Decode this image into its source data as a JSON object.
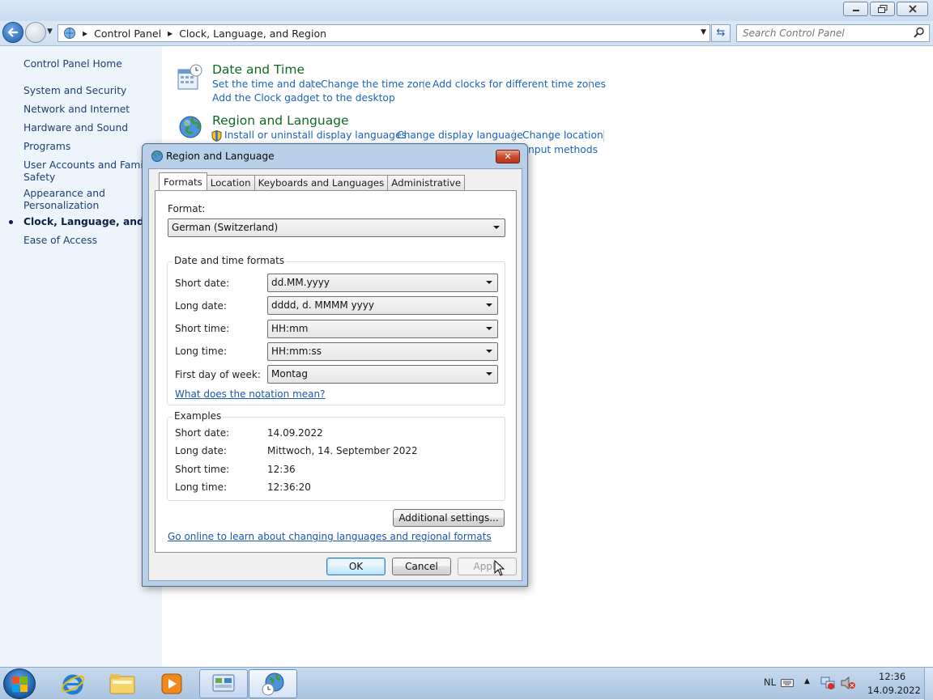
{
  "window": {
    "breadcrumb": [
      "Control Panel",
      "Clock, Language, and Region"
    ],
    "search_placeholder": "Search Control Panel"
  },
  "sidebar": {
    "home": "Control Panel Home",
    "items": [
      "System and Security",
      "Network and Internet",
      "Hardware and Sound",
      "Programs",
      "User Accounts and Family Safety",
      "Appearance and Personalization",
      "Clock, Language, and Region",
      "Ease of Access"
    ],
    "current_index": 6
  },
  "categories": {
    "date_time": {
      "title": "Date and Time",
      "links": [
        "Set the time and date",
        "Change the time zone",
        "Add clocks for different time zones",
        "Add the Clock gadget to the desktop"
      ]
    },
    "region_language": {
      "title": "Region and Language",
      "links": [
        "Install or uninstall display languages",
        "Change display language",
        "Change location",
        "nput methods"
      ]
    }
  },
  "dialog": {
    "title": "Region and Language",
    "tabs": [
      "Formats",
      "Location",
      "Keyboards and Languages",
      "Administrative"
    ],
    "active_tab": "Formats",
    "format_label": "Format:",
    "format_value": "German (Switzerland)",
    "dt_group_title": "Date and time formats",
    "fields": [
      {
        "label": "Short date:",
        "value": "dd.MM.yyyy"
      },
      {
        "label": "Long date:",
        "value": "dddd, d. MMMM yyyy"
      },
      {
        "label": "Short time:",
        "value": "HH:mm"
      },
      {
        "label": "Long time:",
        "value": "HH:mm:ss"
      },
      {
        "label": "First day of week:",
        "value": "Montag"
      }
    ],
    "notation_link": "What does the notation mean?",
    "examples_title": "Examples",
    "examples": [
      {
        "label": "Short date:",
        "value": "14.09.2022"
      },
      {
        "label": "Long date:",
        "value": "Mittwoch, 14. September 2022"
      },
      {
        "label": "Short time:",
        "value": "12:36"
      },
      {
        "label": "Long time:",
        "value": "12:36:20"
      }
    ],
    "additional_settings": "Additional settings...",
    "online_link": "Go online to learn about changing languages and regional formats",
    "ok": "OK",
    "cancel": "Cancel",
    "apply": "Apply"
  },
  "taskbar": {
    "language": "NL",
    "time": "12:36",
    "date": "14.09.2022"
  },
  "colors": {
    "link": "#1c63b7",
    "category_title": "#0d6a25",
    "sidebar_bg": "#eef4fb"
  }
}
